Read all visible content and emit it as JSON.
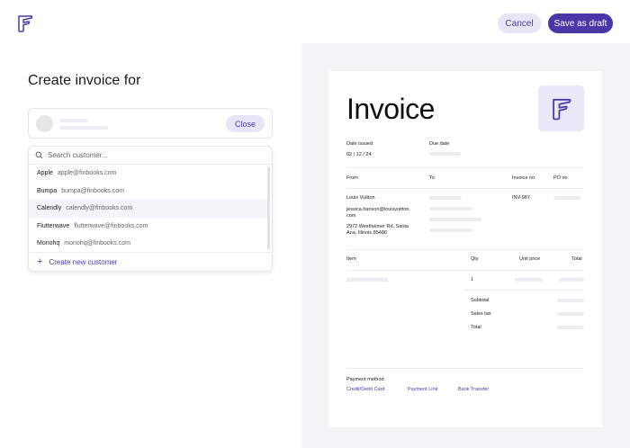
{
  "header": {
    "cancel_label": "Cancel",
    "save_label": "Save as draft",
    "accent": "#4b36a8"
  },
  "left": {
    "heading": "Create invoice for",
    "close_label": "Close",
    "search_placeholder": "Search customer...",
    "customers": [
      {
        "name": "Apple",
        "email": "apple@finbooks.com"
      },
      {
        "name": "Bumpa",
        "email": "bumpa@finbooks.com"
      },
      {
        "name": "Calendly",
        "email": "calendly@finbooks.com"
      },
      {
        "name": "Flutterwave",
        "email": "flutterwave@finbooks.com"
      },
      {
        "name": "Monohq",
        "email": "monohq@finbooks.com"
      }
    ],
    "create_label": "Create new customer"
  },
  "invoice": {
    "title": "Invoice",
    "date_issued_label": "Date issued",
    "date_issued": "02 / 12 / 24",
    "due_date_label": "Due date",
    "from_label": "From",
    "to_label": "To",
    "invoice_no_label": "Invoice no",
    "po_no_label": "PO no",
    "from_name": "Louis Vuitton",
    "from_email_1": "jessica.hanson@louisvuitton.",
    "from_email_2": "com",
    "from_address_1": "2972 Westheimer Rd. Santa",
    "from_address_2": "Ana, Illinois 85486",
    "invoice_no": "INV-987",
    "item_label": "Item",
    "qty_label": "Qty",
    "unit_price_label": "Unit price",
    "total_label": "Total",
    "qty_value": "1",
    "subtotal_label": "Subtotal",
    "sales_tax_label": "Sales tax",
    "grand_total_label": "Total",
    "payment_method_label": "Payment method",
    "payment_methods": [
      "Credit/Debit Card",
      "Payment Link",
      "Bank Transfer"
    ]
  }
}
